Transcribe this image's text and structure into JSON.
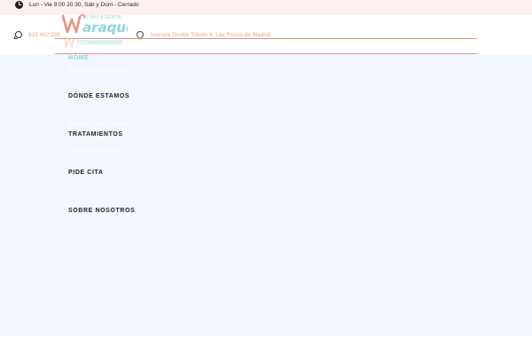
{
  "topbar": {
    "hours_icon": "clock-icon",
    "hours": "Lun - Vie 9:00 20:30, Sáb y Dom - Cerrado"
  },
  "contact": {
    "phone_icon": "whatsapp-icon",
    "phone": "633 902 285",
    "address_icon": "map-pin-icon",
    "address": "Avenida Doctor Toledo 4. Las Rozas de Madrid."
  },
  "logo": {
    "tagline": "CLÍNICA DENTAL",
    "name": "araque"
  },
  "menu": {
    "items": [
      {
        "label": "HOME"
      },
      {
        "label": "DÓNDE ESTAMOS"
      },
      {
        "label": "TRATAMIENTOS"
      },
      {
        "label": "PIDE CITA"
      },
      {
        "label": "SOBRE NOSOTROS"
      }
    ],
    "ghost_items": [
      {
        "label": "HOME"
      },
      {
        "label": "DÓNDE ESTAMOS"
      },
      {
        "label": "DÓNDE ESTAMOS"
      },
      {
        "label": "TRATAMIENTOS"
      }
    ]
  },
  "colors": {
    "accent_coral": "#e8917f",
    "accent_teal": "#8fd5dc",
    "menu_background": "#f1f7fd",
    "topbar_background": "#fdf0f0"
  }
}
